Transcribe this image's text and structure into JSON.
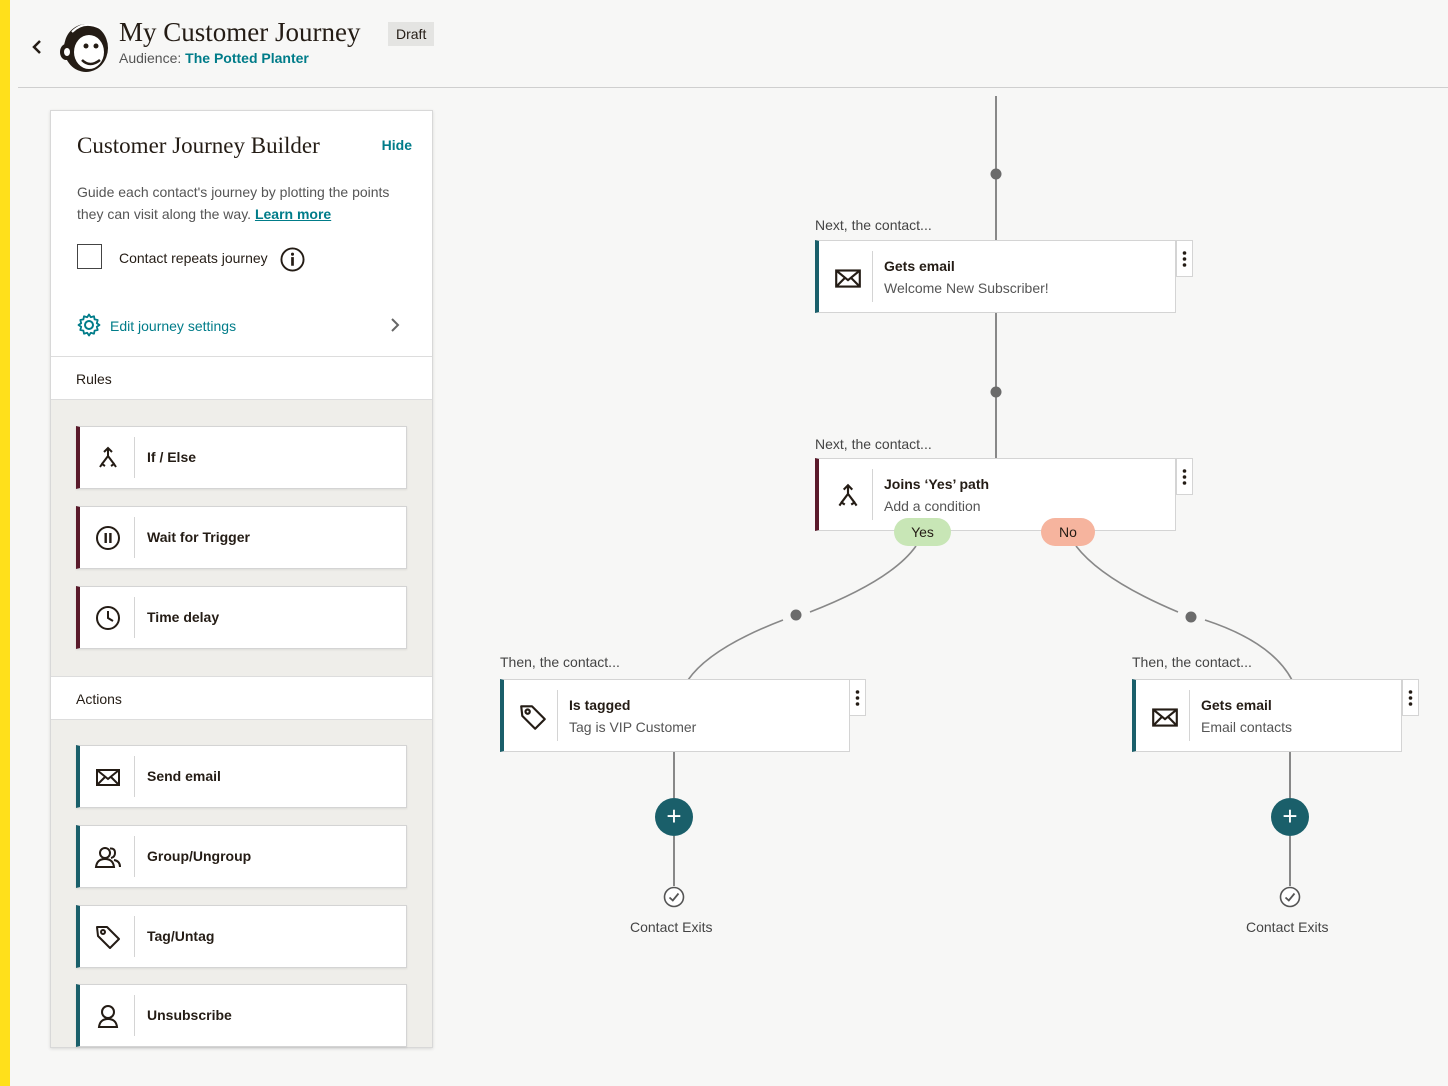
{
  "header": {
    "back_icon": "chevron-left-icon",
    "logo": "mailchimp-logo",
    "title": "My Customer Journey",
    "status_badge": "Draft",
    "audience_label": "Audience:",
    "audience_name": "The Potted Planter"
  },
  "panel": {
    "title": "Customer Journey Builder",
    "hide_label": "Hide",
    "description": "Guide each contact's journey by plotting the points they can visit along the way.",
    "learn_more": "Learn more",
    "repeat_label": "Contact repeats journey",
    "repeat_checked": false,
    "settings_label": "Edit journey settings",
    "rules_heading": "Rules",
    "rules": [
      {
        "label": "If / Else",
        "icon": "branch-icon"
      },
      {
        "label": "Wait for Trigger",
        "icon": "pause-circle-icon"
      },
      {
        "label": "Time delay",
        "icon": "clock-icon"
      }
    ],
    "actions_heading": "Actions",
    "actions": [
      {
        "label": "Send email",
        "icon": "envelope-icon"
      },
      {
        "label": "Group/Ungroup",
        "icon": "people-icon"
      },
      {
        "label": "Tag/Untag",
        "icon": "tag-icon"
      },
      {
        "label": "Unsubscribe",
        "icon": "person-icon"
      }
    ]
  },
  "canvas": {
    "step1": {
      "prefix": "Next, the contact...",
      "title": "Gets email",
      "subtitle": "Welcome New Subscriber!",
      "icon": "envelope-icon"
    },
    "step2": {
      "prefix": "Next, the contact...",
      "title": "Joins ‘Yes’ path",
      "subtitle": "Add a condition",
      "icon": "branch-icon"
    },
    "yes_label": "Yes",
    "no_label": "No",
    "left_branch": {
      "prefix": "Then, the contact...",
      "title": "Is tagged",
      "subtitle": "Tag is VIP Customer",
      "icon": "tag-icon",
      "exit_label": "Contact Exits"
    },
    "right_branch": {
      "prefix": "Then, the contact...",
      "title": "Gets email",
      "subtitle": "Email contacts",
      "icon": "envelope-icon",
      "exit_label": "Contact Exits"
    },
    "add_symbol": "+"
  },
  "colors": {
    "brand_yellow": "#ffe01b",
    "teal": "#007c89",
    "action_border": "#1a5f6a",
    "rule_border": "#5a1a2b",
    "yes_pill": "#c8e6b6",
    "no_pill": "#f6b49e"
  }
}
